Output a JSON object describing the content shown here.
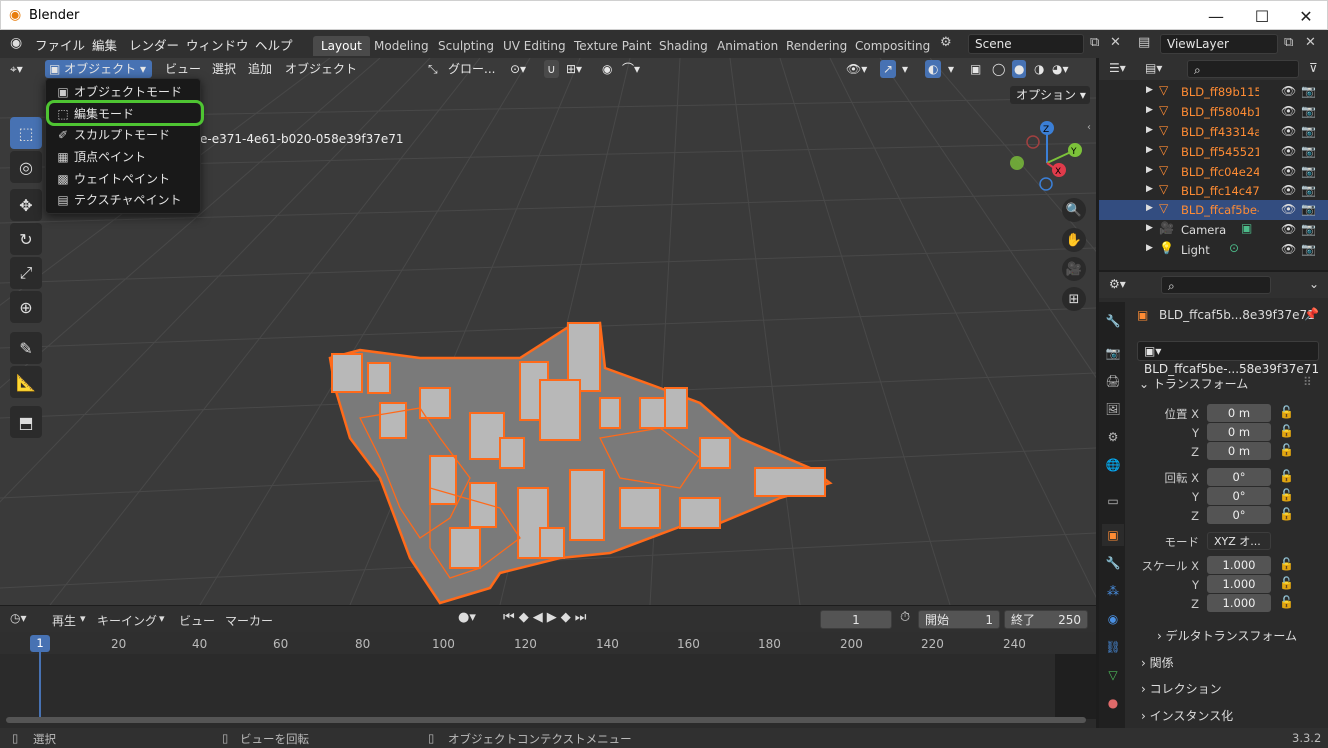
{
  "app": {
    "title": "Blender",
    "version": "3.3.2"
  },
  "menubar": {
    "items": [
      "ファイル",
      "編集",
      "レンダー",
      "ウィンドウ",
      "ヘルプ"
    ]
  },
  "workspaces": [
    "Layout",
    "Modeling",
    "Sculpting",
    "UV Editing",
    "Texture Paint",
    "Shading",
    "Animation",
    "Rendering",
    "Compositing"
  ],
  "scene": {
    "name": "Scene"
  },
  "viewlayer": {
    "name": "ViewLayer"
  },
  "viewport_header": {
    "mode": "オブジェクト",
    "menus": [
      "ビュー",
      "選択",
      "追加",
      "オブジェクト"
    ],
    "transform_orientation": "グロー...",
    "options_label": "オプション",
    "object_label_fragment": "e-e371-4e61-b020-058e39f37e71"
  },
  "mode_dropdown": {
    "items": [
      "オブジェクトモード",
      "編集モード",
      "スカルプトモード",
      "頂点ペイント",
      "ウェイトペイント",
      "テクスチャペイント"
    ],
    "highlighted": "編集モード",
    "highlight_color": "#4ec432"
  },
  "outliner": {
    "rows": [
      {
        "name": "BLD_ff89b115-",
        "type": "mesh",
        "selected": false
      },
      {
        "name": "BLD_ff5804b1-",
        "type": "mesh",
        "selected": false
      },
      {
        "name": "BLD_ff43314a-",
        "type": "mesh",
        "selected": false
      },
      {
        "name": "BLD_ff545521-",
        "type": "mesh",
        "selected": false
      },
      {
        "name": "BLD_ffc04e24-",
        "type": "mesh",
        "selected": false
      },
      {
        "name": "BLD_ffc14c47-",
        "type": "mesh",
        "selected": false
      },
      {
        "name": "BLD_ffcaf5be-",
        "type": "mesh",
        "selected": true
      },
      {
        "name": "Camera",
        "type": "camera",
        "selected": false
      },
      {
        "name": "Light",
        "type": "light",
        "selected": false
      }
    ]
  },
  "properties": {
    "object_name": "BLD_ffcaf5b...8e39f37e71",
    "mesh_name": "BLD_ffcaf5be-...58e39f37e71",
    "transform_header": "トランスフォーム",
    "location_label": "位置 X",
    "rotation_label": "回転 X",
    "scale_label": "スケール X",
    "y_label": "Y",
    "z_label": "Z",
    "location": [
      "0 m",
      "0 m",
      "0 m"
    ],
    "rotation": [
      "0°",
      "0°",
      "0°"
    ],
    "mode_label": "モード",
    "rotation_mode": "XYZ オ...",
    "scale": [
      "1.000",
      "1.000",
      "1.000"
    ],
    "sections": [
      "デルタトランスフォーム",
      "関係",
      "コレクション",
      "インスタンス化"
    ]
  },
  "timeline": {
    "menus": [
      "再生",
      "キーイング",
      "ビュー",
      "マーカー"
    ],
    "current_frame": "1",
    "start_label": "開始",
    "start": "1",
    "end_label": "終了",
    "end": "250",
    "ruler": [
      "1",
      "20",
      "40",
      "60",
      "80",
      "100",
      "120",
      "140",
      "160",
      "180",
      "200",
      "220",
      "240"
    ]
  },
  "statusbar": {
    "select": "選択",
    "rotate_view": "ビューを回転",
    "context_menu": "オブジェクトコンテクストメニュー"
  },
  "colors": {
    "accent": "#4772b3",
    "selected_object": "#ff8c34",
    "highlight": "#4ec432"
  }
}
